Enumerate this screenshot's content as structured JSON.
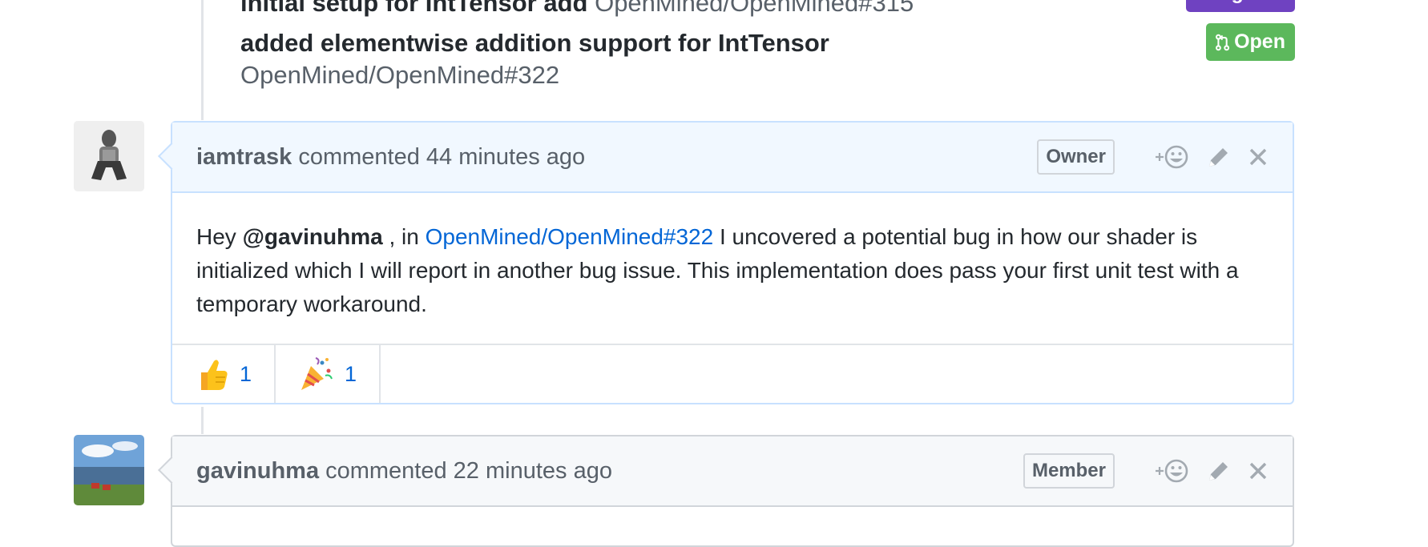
{
  "references": [
    {
      "title": "initial setup for IntTensor add",
      "ref": "OpenMined/OpenMined#315",
      "state": "Merged"
    },
    {
      "title": "added elementwise addition support for IntTensor",
      "ref": "OpenMined/OpenMined#322",
      "state": "Open"
    }
  ],
  "comments": [
    {
      "author": "iamtrask",
      "meta": "commented 44 minutes ago",
      "role": "Owner",
      "body": {
        "prefix": "Hey ",
        "mention": "@gavinuhma",
        "middle": " , in ",
        "link": "OpenMined/OpenMined#322",
        "suffix": " I uncovered a potential bug in how our shader is initialized which I will report in another bug issue. This implementation does pass your first unit test with a temporary workaround."
      },
      "reactions": [
        {
          "emoji": "thumbs-up",
          "count": "1"
        },
        {
          "emoji": "tada",
          "count": "1"
        }
      ]
    },
    {
      "author": "gavinuhma",
      "meta": "commented 22 minutes ago",
      "role": "Member"
    }
  ],
  "colors": {
    "open": "#5cb85c",
    "merged": "#6f42c1",
    "link": "#0366d6",
    "header_blue": "#f1f8ff"
  }
}
